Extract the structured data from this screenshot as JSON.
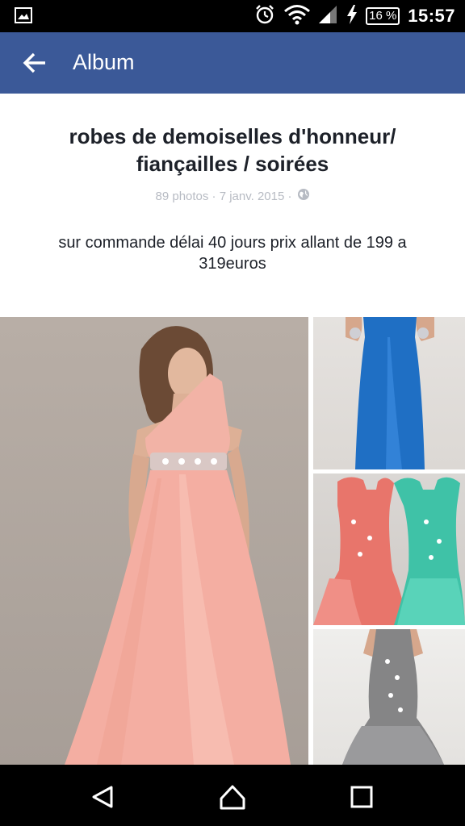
{
  "status_bar": {
    "battery": "16 %",
    "time": "15:57"
  },
  "app_bar": {
    "title": "Album"
  },
  "album": {
    "title": "robes de demoiselles d'honneur/ fiançailles / soirées",
    "meta": "89 photos · 7 janv. 2015 ·",
    "description": "sur commande délai 40 jours prix allant de 199 a 319euros"
  },
  "colors": {
    "app_bar": "#3b5998",
    "status_bar": "#000000",
    "nav_bar": "#000000"
  },
  "icons": {
    "status_left": "image-notification-icon",
    "alarm": "alarm-icon",
    "wifi": "wifi-icon",
    "signal": "signal-icon",
    "charging": "charging-icon",
    "back": "arrow-left-icon",
    "globe": "globe-icon",
    "nav_back": "triangle-back-icon",
    "nav_home": "home-icon",
    "nav_recents": "square-recents-icon"
  }
}
